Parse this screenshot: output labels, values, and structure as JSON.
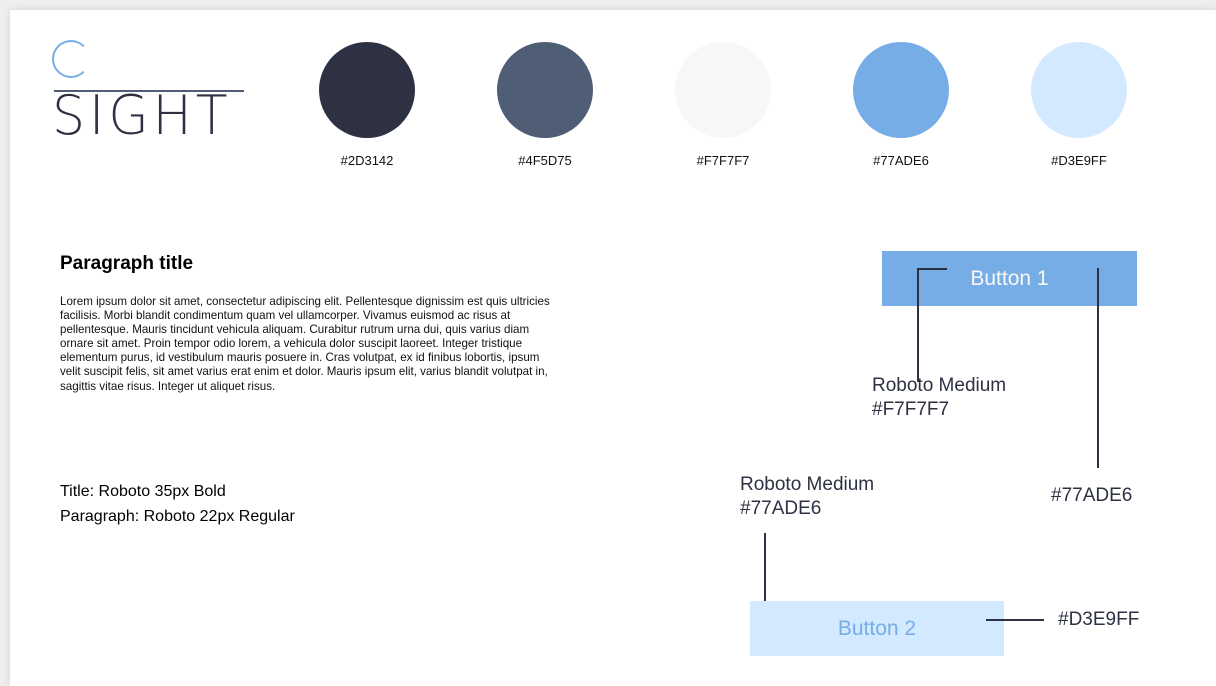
{
  "logo": {
    "letter": "C",
    "word": "SIGHT"
  },
  "palette": [
    {
      "hex": "#2D3142",
      "color": "#2D3142"
    },
    {
      "hex": "#4F5D75",
      "color": "#4F5D75"
    },
    {
      "hex": "#F7F7F7",
      "color": "#F7F7F7"
    },
    {
      "hex": "#77ADE6",
      "color": "#77ADE6"
    },
    {
      "hex": "#D3E9FF",
      "color": "#D3E9FF"
    }
  ],
  "paragraph": {
    "title": "Paragraph title",
    "body": "Lorem ipsum dolor sit amet, consectetur adipiscing elit. Pellentesque dignissim est quis ultricies facilisis. Morbi blandit condimentum quam vel ullamcorper. Vivamus euismod ac risus at pellentesque. Mauris tincidunt vehicula aliquam. Curabitur rutrum urna dui, quis varius diam ornare sit amet. Proin tempor odio lorem, a vehicula dolor suscipit laoreet. Integer tristique elementum purus, id vestibulum mauris posuere in. Cras volutpat, ex id finibus lobortis, ipsum velit suscipit felis, sit amet varius erat enim et dolor. Mauris ipsum elit, varius blandit volutpat in, sagittis vitae risus. Integer ut aliquet risus."
  },
  "typography": {
    "title_spec": "Title: Roboto 35px Bold",
    "paragraph_spec": "Paragraph: Roboto 22px Regular"
  },
  "button1": {
    "label": "Button 1",
    "text_font": "Roboto Medium",
    "text_color": "#F7F7F7",
    "bg_color": "#77ADE6"
  },
  "button2": {
    "label": "Button 2",
    "text_font": "Roboto Medium",
    "text_color": "#77ADE6",
    "bg_color": "#D3E9FF"
  }
}
